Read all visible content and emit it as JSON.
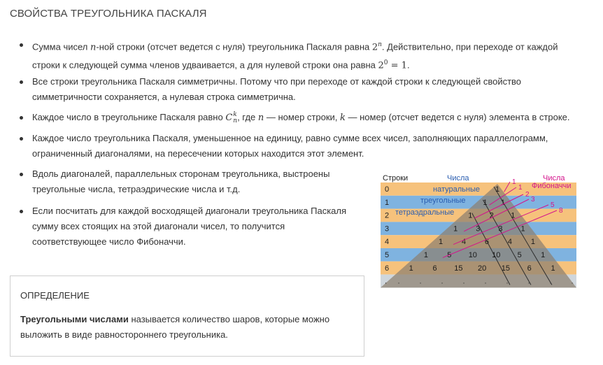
{
  "title": "СВОЙСТВА ТРЕУГОЛЬНИКА ПАСКАЛЯ",
  "properties": {
    "p1": {
      "a": "Сумма чисел ",
      "n": "n",
      "b": "-ной строки (отсчет ведется с нуля) треугольника Паскаля равна ",
      "pow": "2",
      "powexp": "n",
      "c": ". Действительно, при переходе от каждой",
      "d": "строки к следующей сумма членов удваивается, а для нулевой строки она равна ",
      "eq": "2",
      "eqexp": "0",
      "eqres": " = 1",
      "e": "."
    },
    "p2": {
      "l1": "Все строки треугольника Паскаля симметричны. Потому что при переходе от каждой строки к следующей свойство",
      "l2": "симметричности сохраняется, а нулевая строка симметрична."
    },
    "p3": {
      "a": "Каждое число в треугольнике Паскаля равно ",
      "c": "C",
      "csup": "k",
      "csub": "n",
      "b": ", где ",
      "n": "n",
      "c2": " — номер строки, ",
      "k": "k",
      "d": " — номер (отсчет ведется с нуля) элемента в строке."
    },
    "p4": {
      "l1": "Каждое число треугольника Паскаля, уменьшенное на единицу, равно сумме всех чисел, заполняющих параллелограмм,",
      "l2": "ограниченный диагоналями, на пересечении которых находится этот элемент."
    },
    "p5": {
      "l1": "Вдоль диагоналей, параллельных сторонам треугольника, выстроены",
      "l2": "треугольные числа, тетраэдрические числа и т.д."
    },
    "p6": {
      "l1": "Если посчитать для каждой восходящей диагонали треугольника Паскаля",
      "l2": "сумму всех стоящих на этой диагонали чисел, то получится",
      "l3": "соответствующее число Фибоначчи."
    }
  },
  "definition": {
    "heading": "ОПРЕДЕЛЕНИЕ",
    "term": "Треугольными числами",
    "text1": " называется количество шаров, которые можно",
    "text2": "выложить в виде равностороннего треугольника."
  },
  "figure": {
    "label_rows": "Строки",
    "label_numbers": "Числа",
    "label_fib1": "Числа",
    "label_fib2": "Фибоначчи",
    "label_natural": "натуральные",
    "label_triangular": "треугольные",
    "label_tetra": "тетраэдральные",
    "row_numbers": [
      "0",
      "1",
      "2",
      "3",
      "4",
      "5",
      "6",
      "."
    ],
    "rows": [
      [
        "1"
      ],
      [
        "1",
        "1"
      ],
      [
        "1",
        "2",
        "1"
      ],
      [
        "1",
        "3",
        "3",
        "1"
      ],
      [
        "1",
        "4",
        "6",
        "4",
        "1"
      ],
      [
        "1",
        "5",
        "10",
        "10",
        "5",
        "1"
      ],
      [
        "1",
        "6",
        "15",
        "20",
        "15",
        "6",
        "1"
      ]
    ],
    "fibonacci": [
      "1",
      "1",
      "2",
      "3",
      "5",
      "8"
    ],
    "colors": {
      "band_orange": "#f6c27c",
      "band_blue": "#7fb3e0",
      "triangle": "#8c7f70",
      "magenta": "#d4148c",
      "text_blue": "#2a5db0"
    }
  }
}
